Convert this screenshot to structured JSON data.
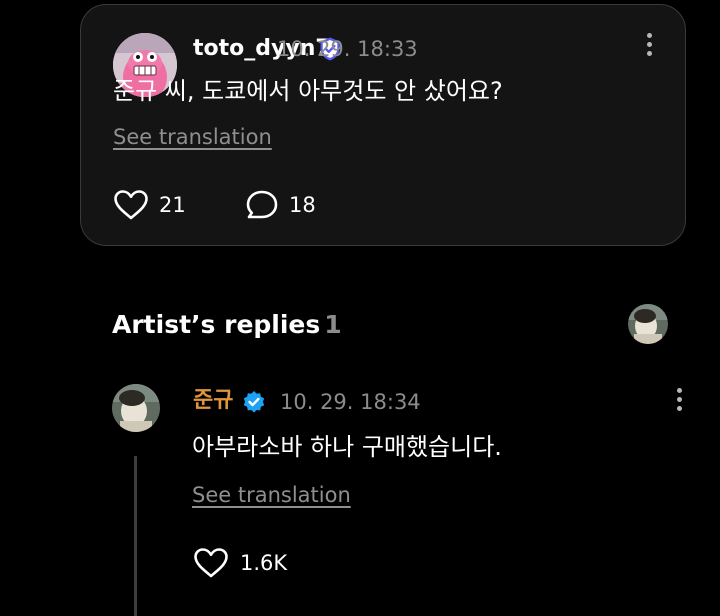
{
  "comment": {
    "username": "toto_dyyn7",
    "timestamp": "10. 29. 18:33",
    "text": "준규 씨, 도쿄에서 아무것도 안 샀어요?",
    "see_translation": "See translation",
    "likes": "21",
    "replies": "18"
  },
  "artist_replies": {
    "title": "Artist’s replies",
    "count": "1",
    "reply": {
      "username": "준규",
      "timestamp": "10. 29. 18:34",
      "text": "아부라소바 하나 구매했습니다.",
      "see_translation": "See translation",
      "likes": "1.6K"
    }
  },
  "colors": {
    "background": "#000000",
    "card": "#141414",
    "card_border": "#3a3a3a",
    "muted_text": "#8c8c8c",
    "artist_name": "#e0953d",
    "user_badge": "#5b5bf0",
    "artist_badge": "#1da1f2"
  },
  "icons": {
    "user_badge": "shield-check-icon",
    "artist_badge": "verified-check-icon",
    "like": "heart-icon",
    "reply": "speech-bubble-icon",
    "more": "more-vertical-icon"
  }
}
